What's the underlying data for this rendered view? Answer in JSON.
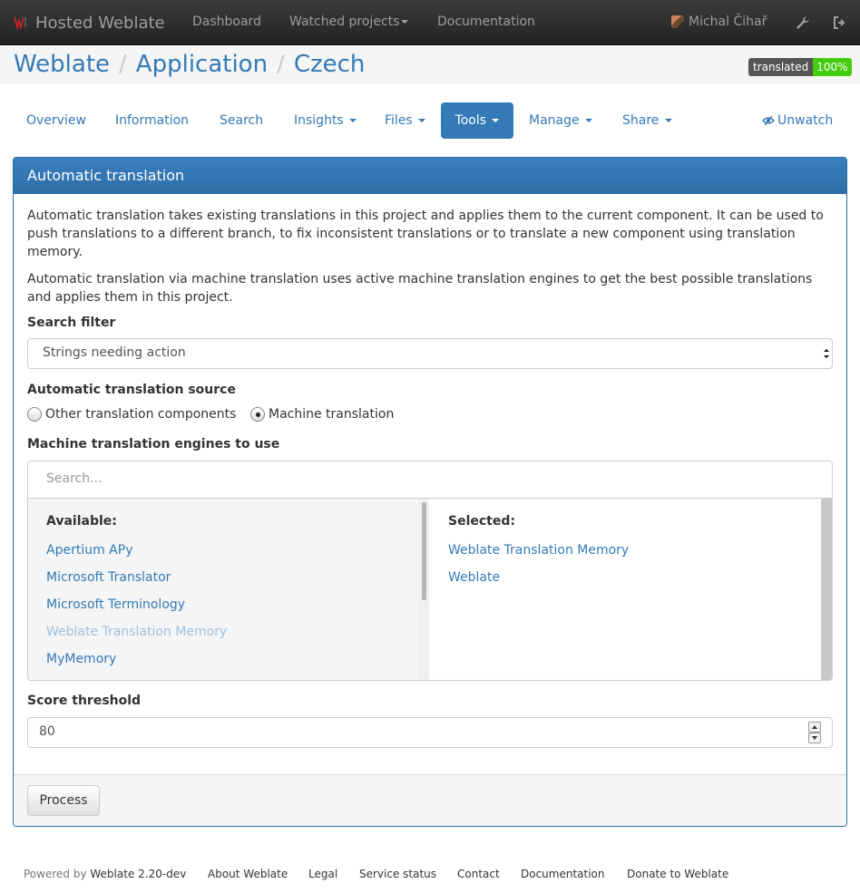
{
  "navbar": {
    "brand": "Hosted Weblate",
    "items": [
      "Dashboard",
      "Watched projects",
      "Documentation"
    ],
    "user": "Michal Čihař",
    "icons": [
      "wrench-icon",
      "sign-out-icon"
    ]
  },
  "breadcrumb": [
    "Weblate",
    "Application",
    "Czech"
  ],
  "badge": {
    "label": "translated",
    "value": "100%"
  },
  "tabs": [
    "Overview",
    "Information",
    "Search",
    "Insights",
    "Files",
    "Tools",
    "Manage",
    "Share"
  ],
  "active_tab": "Tools",
  "unwatch": "Unwatch",
  "panel": {
    "title": "Automatic translation",
    "para1": "Automatic translation takes existing translations in this project and applies them to the current component. It can be used to push translations to a different branch, to fix inconsistent translations or to translate a new component using translation memory.",
    "para2": "Automatic translation via machine translation uses active machine translation engines to get the best possible translations and applies them in this project.",
    "filter_label": "Search filter",
    "filter_value": "Strings needing action",
    "source_label": "Automatic translation source",
    "source_options": [
      "Other translation components",
      "Machine translation"
    ],
    "source_selected": "Machine translation",
    "engines_label": "Machine translation engines to use",
    "engines_search_placeholder": "Search...",
    "available_title": "Available:",
    "available": [
      "Apertium APy",
      "Microsoft Translator",
      "Microsoft Terminology",
      "Weblate Translation Memory",
      "MyMemory"
    ],
    "selected_title": "Selected:",
    "selected": [
      "Weblate Translation Memory",
      "Weblate"
    ],
    "threshold_label": "Score threshold",
    "threshold_value": "80",
    "process_button": "Process"
  },
  "footer": {
    "powered_prefix": "Powered by",
    "powered_link": "Weblate 2.20-dev",
    "links": [
      "About Weblate",
      "Legal",
      "Service status",
      "Contact",
      "Documentation",
      "Donate to Weblate"
    ]
  },
  "colors": {
    "accent": "#337ab7",
    "navbar": "#222222",
    "badge_ok": "#44cc11"
  }
}
